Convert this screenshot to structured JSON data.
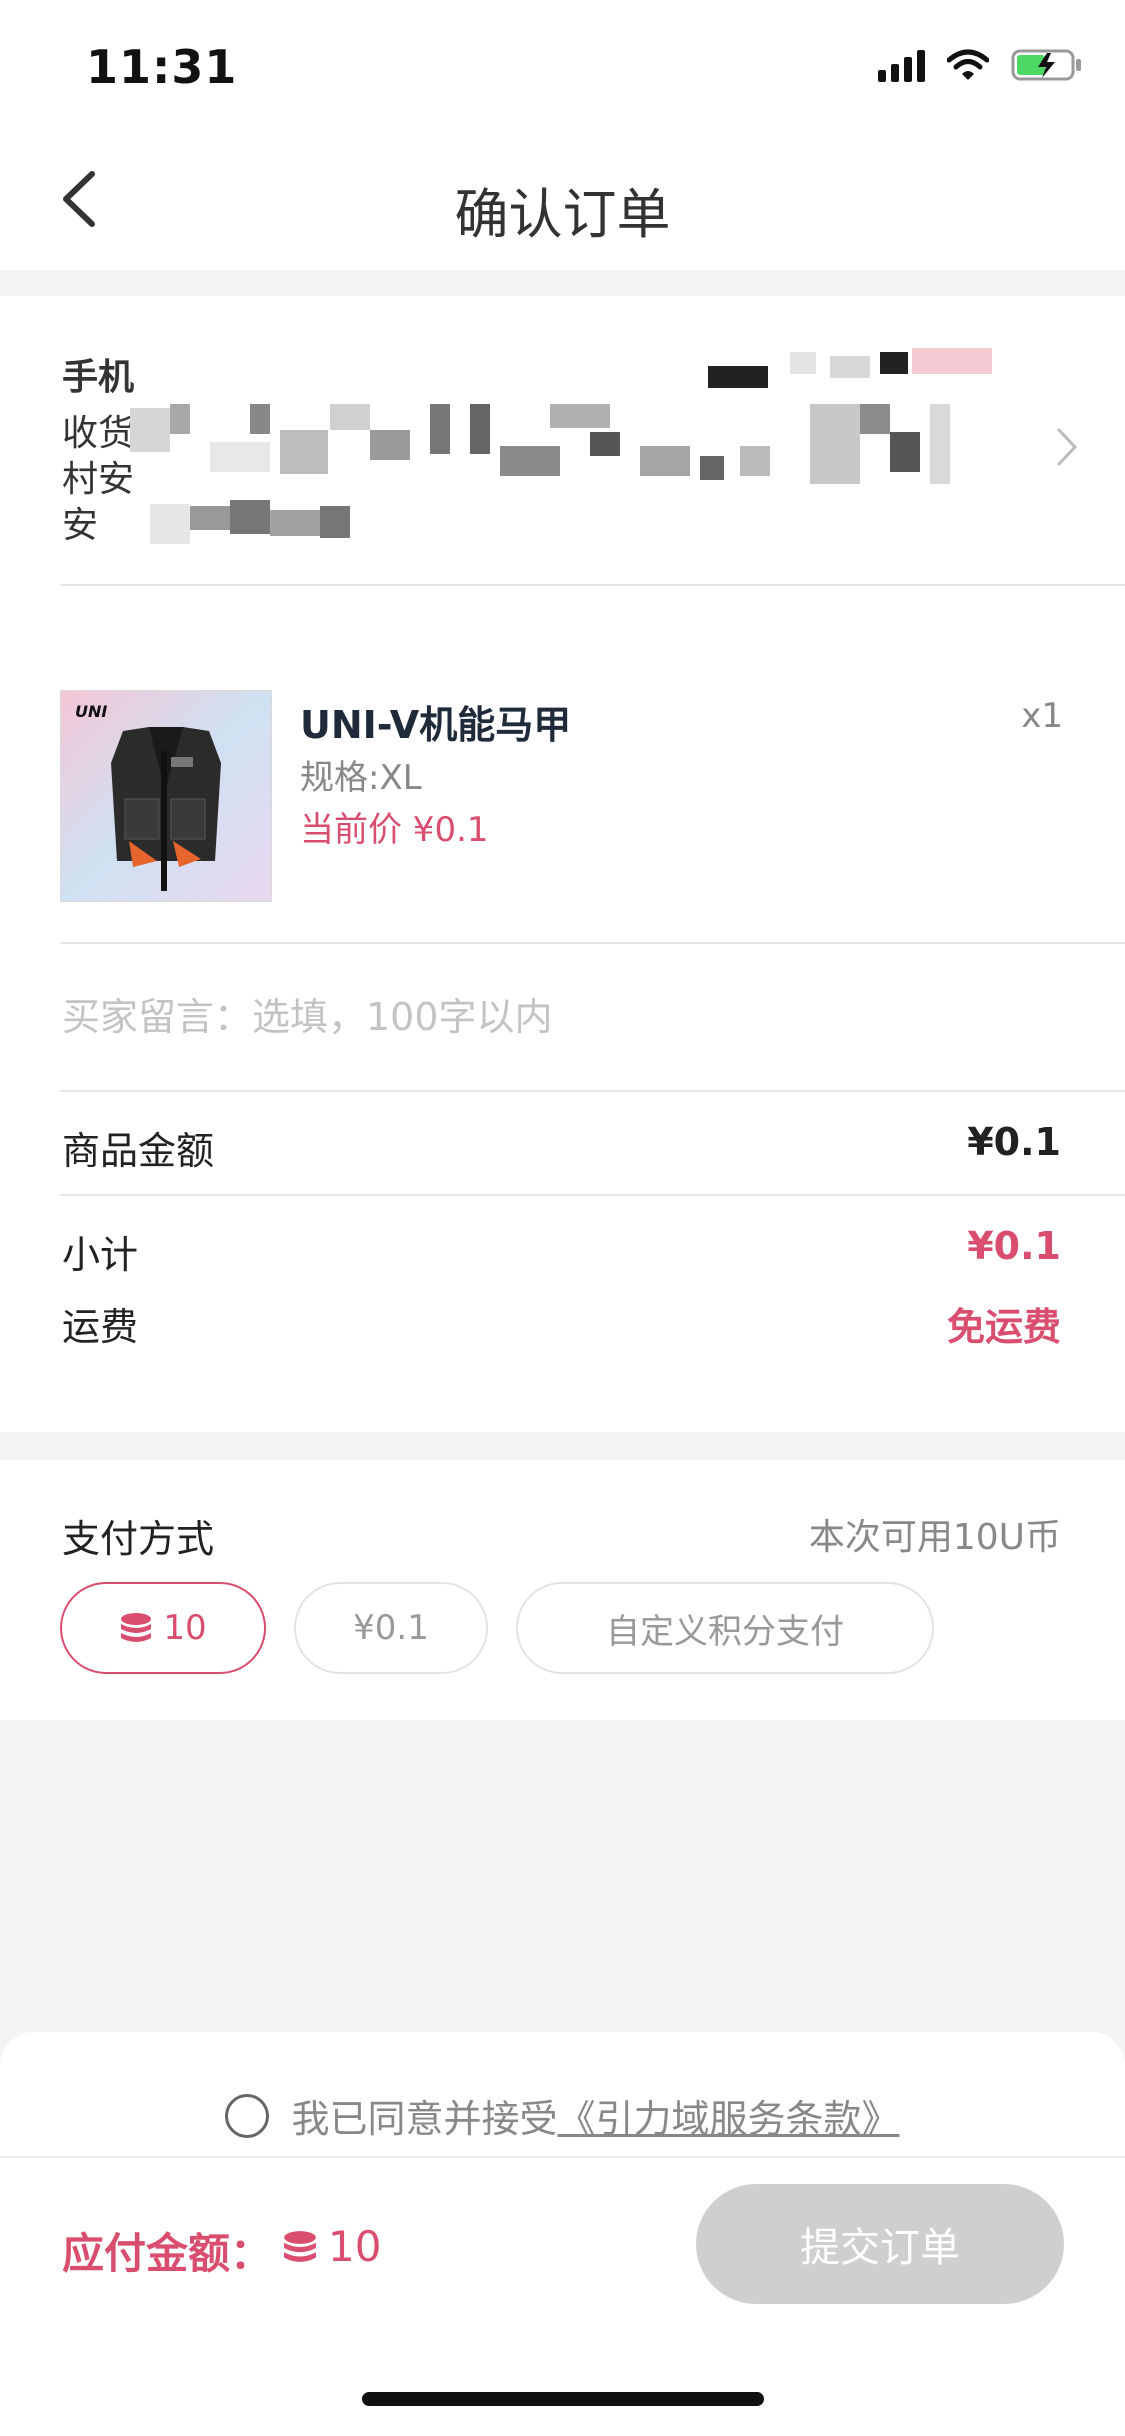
{
  "status_bar": {
    "time": "11:31"
  },
  "nav": {
    "title": "确认订单"
  },
  "address": {
    "line1_prefix": "手机",
    "line2_prefix": "收货",
    "line3_prefix": "村安",
    "line4_prefix": "安"
  },
  "product": {
    "brand_logo": "UNI",
    "name": "UNI-V机能马甲",
    "quantity": "x1",
    "spec": "规格:XL",
    "price": "当前价 ¥0.1"
  },
  "remark": {
    "placeholder": "买家留言：选填，100字以内"
  },
  "summary": {
    "goods_amount_label": "商品金额",
    "goods_amount_value": "¥0.1",
    "subtotal_label": "小计",
    "subtotal_value": "¥0.1",
    "shipping_label": "运费",
    "shipping_value": "免运费"
  },
  "payment": {
    "title": "支付方式",
    "available_note": "本次可用10U币",
    "options": [
      {
        "label": "10",
        "selected": true
      },
      {
        "label": "¥0.1",
        "selected": false
      },
      {
        "label": "自定义积分支付",
        "selected": false
      }
    ]
  },
  "footer": {
    "agree_text": "我已同意并接受",
    "agree_link": "《引力域服务条款》",
    "total_label": "应付金额：",
    "total_value": "10",
    "submit_label": "提交订单"
  },
  "colors": {
    "accent": "#d94e6e",
    "disabled_button": "#cfcfcf"
  }
}
